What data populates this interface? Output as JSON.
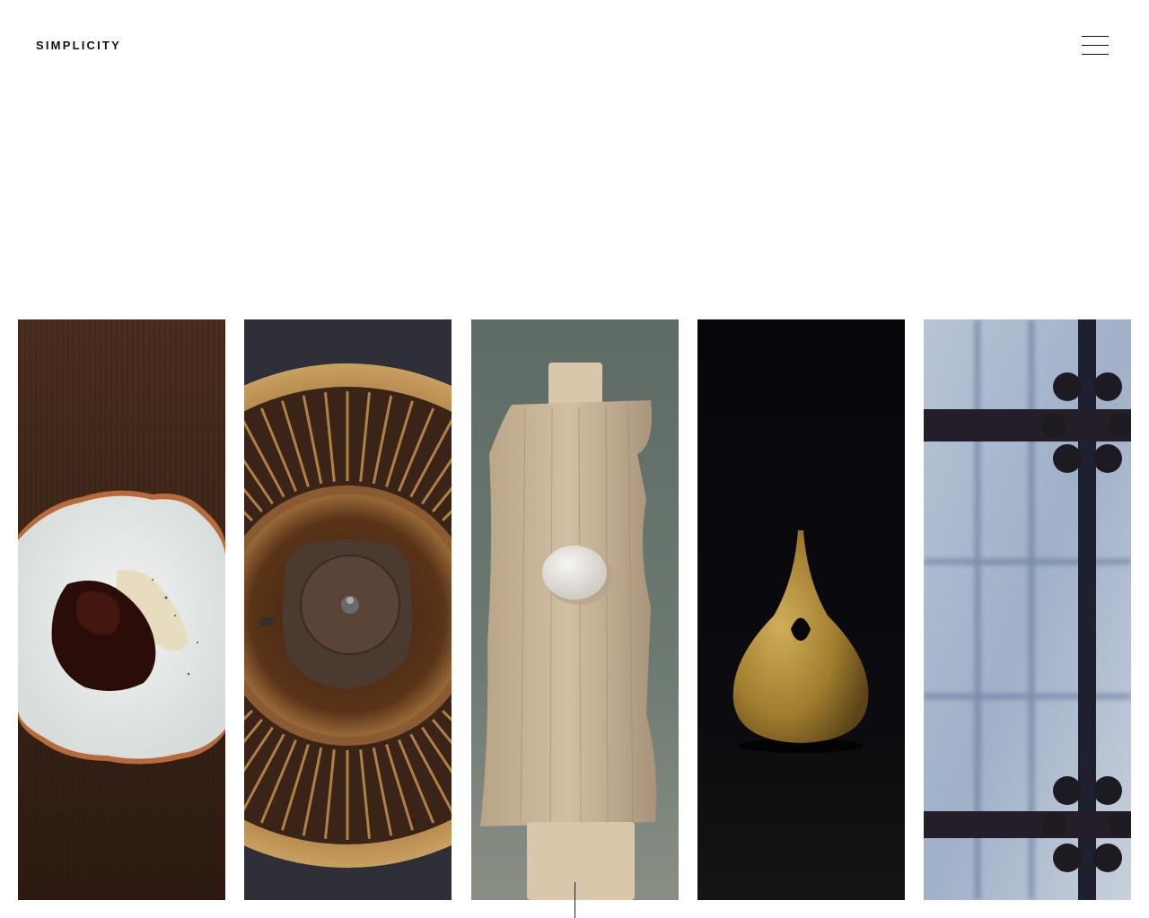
{
  "header": {
    "logo_text": "SIMPLICITY",
    "menu_icon": "hamburger-menu-icon"
  },
  "gallery": {
    "panels": [
      {
        "subject": "plated-dish-photo",
        "colors": {
          "bg": "#3a2418",
          "plate": "#e9ecea",
          "rim": "#b86a3a"
        }
      },
      {
        "subject": "iron-kettle-brazier-photo",
        "colors": {
          "bg": "#2e2f38",
          "brass": "#b08045",
          "kettle": "#4a3a30"
        }
      },
      {
        "subject": "wooden-tray-sweet-photo",
        "colors": {
          "bg": "#6d7a72",
          "wood": "#c8b49a",
          "sweet": "#eeece6"
        }
      },
      {
        "subject": "brass-vase-photo",
        "colors": {
          "bg": "#0c0c10",
          "brass": "#a07d2e"
        }
      },
      {
        "subject": "window-lattice-photo",
        "colors": {
          "bg": "#9fb0c8",
          "frame": "#1e2030"
        }
      }
    ]
  },
  "scroll_indicator": {
    "icon": "scroll-down-line-icon"
  }
}
